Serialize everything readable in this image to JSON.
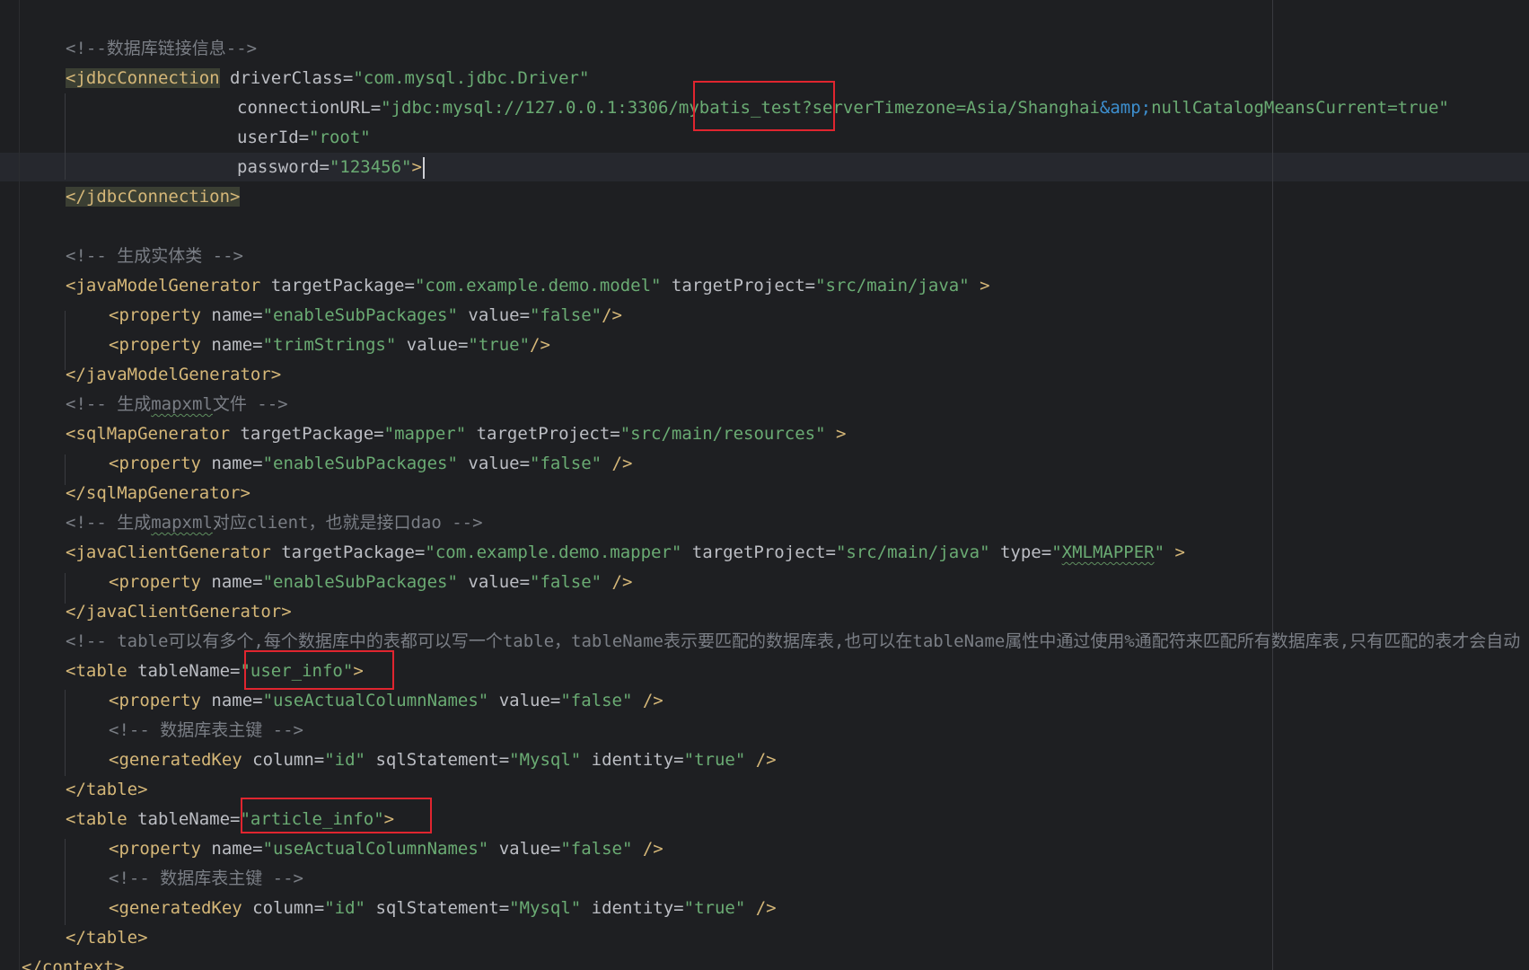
{
  "editor": {
    "lines": [
      {
        "indent": 73,
        "tokens": [
          {
            "k": "c",
            "v": "<!--数据库链接信息-->"
          }
        ]
      },
      {
        "indent": 73,
        "tokens": [
          {
            "k": "t",
            "v": "<jdbcConnection",
            "hl": true
          },
          {
            "k": "a",
            "v": " driverClass="
          },
          {
            "k": "s",
            "v": "\"com.mysql.jdbc.Driver\""
          }
        ]
      },
      {
        "indent": 264,
        "tokens": [
          {
            "k": "a",
            "v": "connectionURL="
          },
          {
            "k": "s",
            "v": "\"jdbc:mysql://127.0.0.1:3306/mybatis_test?serverTimezone=Asia/Shanghai"
          },
          {
            "k": "e",
            "v": "&amp;"
          },
          {
            "k": "s",
            "v": "nullCatalogMeansCurrent=true\""
          }
        ]
      },
      {
        "indent": 264,
        "tokens": [
          {
            "k": "a",
            "v": "userId="
          },
          {
            "k": "s",
            "v": "\"root\""
          }
        ]
      },
      {
        "indent": 264,
        "tokens": [
          {
            "k": "a",
            "v": "password="
          },
          {
            "k": "s",
            "v": "\"123456\""
          },
          {
            "k": "t",
            "v": ">"
          }
        ],
        "caret": true
      },
      {
        "indent": 73,
        "tokens": [
          {
            "k": "t",
            "v": "</jdbcConnection>",
            "hl": true
          }
        ]
      },
      {
        "indent": 73,
        "tokens": []
      },
      {
        "indent": 73,
        "tokens": [
          {
            "k": "c",
            "v": "<!-- 生成实体类 -->"
          }
        ]
      },
      {
        "indent": 73,
        "tokens": [
          {
            "k": "t",
            "v": "<javaModelGenerator"
          },
          {
            "k": "a",
            "v": " targetPackage="
          },
          {
            "k": "s",
            "v": "\"com.example.demo.model\""
          },
          {
            "k": "a",
            "v": " targetProject="
          },
          {
            "k": "s",
            "v": "\"src/main/java\""
          },
          {
            "k": "t",
            "v": " >"
          }
        ]
      },
      {
        "indent": 121,
        "tokens": [
          {
            "k": "t",
            "v": "<property"
          },
          {
            "k": "a",
            "v": " name="
          },
          {
            "k": "s",
            "v": "\"enableSubPackages\""
          },
          {
            "k": "a",
            "v": " value="
          },
          {
            "k": "s",
            "v": "\"false\""
          },
          {
            "k": "t",
            "v": "/>"
          }
        ]
      },
      {
        "indent": 121,
        "tokens": [
          {
            "k": "t",
            "v": "<property"
          },
          {
            "k": "a",
            "v": " name="
          },
          {
            "k": "s",
            "v": "\"trimStrings\""
          },
          {
            "k": "a",
            "v": " value="
          },
          {
            "k": "s",
            "v": "\"true\""
          },
          {
            "k": "t",
            "v": "/>"
          }
        ]
      },
      {
        "indent": 73,
        "tokens": [
          {
            "k": "t",
            "v": "</javaModelGenerator>"
          }
        ]
      },
      {
        "indent": 73,
        "tokens": [
          {
            "k": "c",
            "v": "<!-- 生成"
          },
          {
            "k": "c",
            "v": "mapxml",
            "sq": true
          },
          {
            "k": "c",
            "v": "文件 -->"
          }
        ]
      },
      {
        "indent": 73,
        "tokens": [
          {
            "k": "t",
            "v": "<sqlMapGenerator"
          },
          {
            "k": "a",
            "v": " targetPackage="
          },
          {
            "k": "s",
            "v": "\"mapper\""
          },
          {
            "k": "a",
            "v": " targetProject="
          },
          {
            "k": "s",
            "v": "\"src/main/resources\""
          },
          {
            "k": "t",
            "v": " >"
          }
        ]
      },
      {
        "indent": 121,
        "tokens": [
          {
            "k": "t",
            "v": "<property"
          },
          {
            "k": "a",
            "v": " name="
          },
          {
            "k": "s",
            "v": "\"enableSubPackages\""
          },
          {
            "k": "a",
            "v": " value="
          },
          {
            "k": "s",
            "v": "\"false\""
          },
          {
            "k": "t",
            "v": " />"
          }
        ]
      },
      {
        "indent": 73,
        "tokens": [
          {
            "k": "t",
            "v": "</sqlMapGenerator>"
          }
        ]
      },
      {
        "indent": 73,
        "tokens": [
          {
            "k": "c",
            "v": "<!-- 生成"
          },
          {
            "k": "c",
            "v": "mapxml",
            "sq": true
          },
          {
            "k": "c",
            "v": "对应client，也就是接口dao -->"
          }
        ]
      },
      {
        "indent": 73,
        "tokens": [
          {
            "k": "t",
            "v": "<javaClientGenerator"
          },
          {
            "k": "a",
            "v": " targetPackage="
          },
          {
            "k": "s",
            "v": "\"com.example.demo.mapper\""
          },
          {
            "k": "a",
            "v": " targetProject="
          },
          {
            "k": "s",
            "v": "\"src/main/java\""
          },
          {
            "k": "a",
            "v": " type="
          },
          {
            "k": "s",
            "v": "\""
          },
          {
            "k": "s",
            "v": "XMLMAPPER",
            "sq": true
          },
          {
            "k": "s",
            "v": "\""
          },
          {
            "k": "t",
            "v": " >"
          }
        ]
      },
      {
        "indent": 121,
        "tokens": [
          {
            "k": "t",
            "v": "<property"
          },
          {
            "k": "a",
            "v": " name="
          },
          {
            "k": "s",
            "v": "\"enableSubPackages\""
          },
          {
            "k": "a",
            "v": " value="
          },
          {
            "k": "s",
            "v": "\"false\""
          },
          {
            "k": "t",
            "v": " />"
          }
        ]
      },
      {
        "indent": 73,
        "tokens": [
          {
            "k": "t",
            "v": "</javaClientGenerator>"
          }
        ]
      },
      {
        "indent": 73,
        "tokens": [
          {
            "k": "c",
            "v": "<!-- table可以有多个,每个数据库中的表都可以写一个table，tableName表示要匹配的数据库表,也可以在tableName属性中通过使用%通配符来匹配所有数据库表,只有匹配的表才会自动"
          }
        ]
      },
      {
        "indent": 73,
        "tokens": [
          {
            "k": "t",
            "v": "<table"
          },
          {
            "k": "a",
            "v": " tableName="
          },
          {
            "k": "s",
            "v": "\"user_info\""
          },
          {
            "k": "t",
            "v": ">"
          }
        ]
      },
      {
        "indent": 121,
        "tokens": [
          {
            "k": "t",
            "v": "<property"
          },
          {
            "k": "a",
            "v": " name="
          },
          {
            "k": "s",
            "v": "\"useActualColumnNames\""
          },
          {
            "k": "a",
            "v": " value="
          },
          {
            "k": "s",
            "v": "\"false\""
          },
          {
            "k": "t",
            "v": " />"
          }
        ]
      },
      {
        "indent": 121,
        "tokens": [
          {
            "k": "c",
            "v": "<!-- 数据库表主键 -->"
          }
        ]
      },
      {
        "indent": 121,
        "tokens": [
          {
            "k": "t",
            "v": "<generatedKey"
          },
          {
            "k": "a",
            "v": " column="
          },
          {
            "k": "s",
            "v": "\"id\""
          },
          {
            "k": "a",
            "v": " sqlStatement="
          },
          {
            "k": "s",
            "v": "\"Mysql\""
          },
          {
            "k": "a",
            "v": " identity="
          },
          {
            "k": "s",
            "v": "\"true\""
          },
          {
            "k": "t",
            "v": " />"
          }
        ]
      },
      {
        "indent": 73,
        "tokens": [
          {
            "k": "t",
            "v": "</table>"
          }
        ]
      },
      {
        "indent": 73,
        "tokens": [
          {
            "k": "t",
            "v": "<table"
          },
          {
            "k": "a",
            "v": " tableName="
          },
          {
            "k": "s",
            "v": "\"article_info\""
          },
          {
            "k": "t",
            "v": ">"
          }
        ]
      },
      {
        "indent": 121,
        "tokens": [
          {
            "k": "t",
            "v": "<property"
          },
          {
            "k": "a",
            "v": " name="
          },
          {
            "k": "s",
            "v": "\"useActualColumnNames\""
          },
          {
            "k": "a",
            "v": " value="
          },
          {
            "k": "s",
            "v": "\"false\""
          },
          {
            "k": "t",
            "v": " />"
          }
        ]
      },
      {
        "indent": 121,
        "tokens": [
          {
            "k": "c",
            "v": "<!-- 数据库表主键 -->"
          }
        ]
      },
      {
        "indent": 121,
        "tokens": [
          {
            "k": "t",
            "v": "<generatedKey"
          },
          {
            "k": "a",
            "v": " column="
          },
          {
            "k": "s",
            "v": "\"id\""
          },
          {
            "k": "a",
            "v": " sqlStatement="
          },
          {
            "k": "s",
            "v": "\"Mysql\""
          },
          {
            "k": "a",
            "v": " identity="
          },
          {
            "k": "s",
            "v": "\"true\""
          },
          {
            "k": "t",
            "v": " />"
          }
        ]
      },
      {
        "indent": 73,
        "tokens": [
          {
            "k": "t",
            "v": "</table>"
          }
        ]
      },
      {
        "indent": 24,
        "tokens": [
          {
            "k": "t",
            "v": "</context>"
          }
        ]
      }
    ]
  },
  "theme": {
    "background": "#1e1f22",
    "tag": "#d5b778",
    "attribute": "#bcbec4",
    "string": "#6aab73",
    "comment": "#7a7e85",
    "entity": "#3d8fcf",
    "annotation_box": "#e0252f"
  }
}
